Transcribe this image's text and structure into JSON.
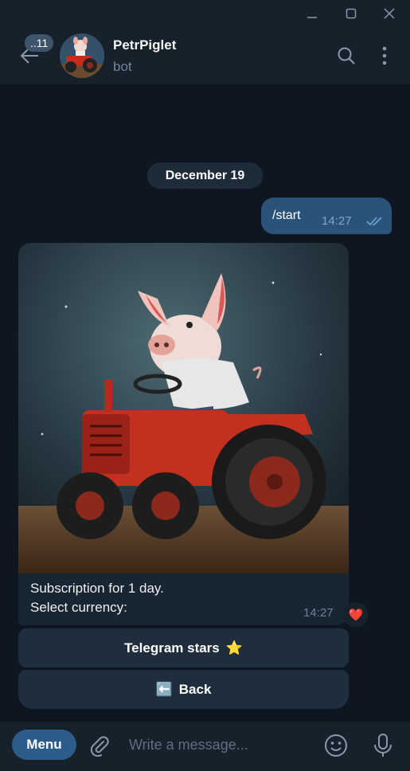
{
  "window": {
    "minimize": "minimize",
    "maximize": "maximize",
    "close": "close"
  },
  "header": {
    "unread_count": "..11",
    "name": "PetrPiglet",
    "status": "bot"
  },
  "chat": {
    "date": "December 19",
    "outgoing": {
      "text": "/start",
      "time": "14:27"
    },
    "incoming": {
      "caption_line1": "Subscription for 1 day.",
      "caption_line2": "Select currency:",
      "time": "14:27",
      "reaction": "❤️"
    },
    "buttons": [
      {
        "label": "Telegram stars",
        "emoji": "⭐"
      },
      {
        "label": "Back",
        "emoji": "⬅️"
      }
    ]
  },
  "composer": {
    "menu_label": "Menu",
    "placeholder": "Write a message..."
  },
  "colors": {
    "background": "#0e1621",
    "panel": "#17212b",
    "outgoing_bubble": "#2b5278",
    "incoming_bubble": "#182533",
    "accent": "#2b5c8a"
  }
}
